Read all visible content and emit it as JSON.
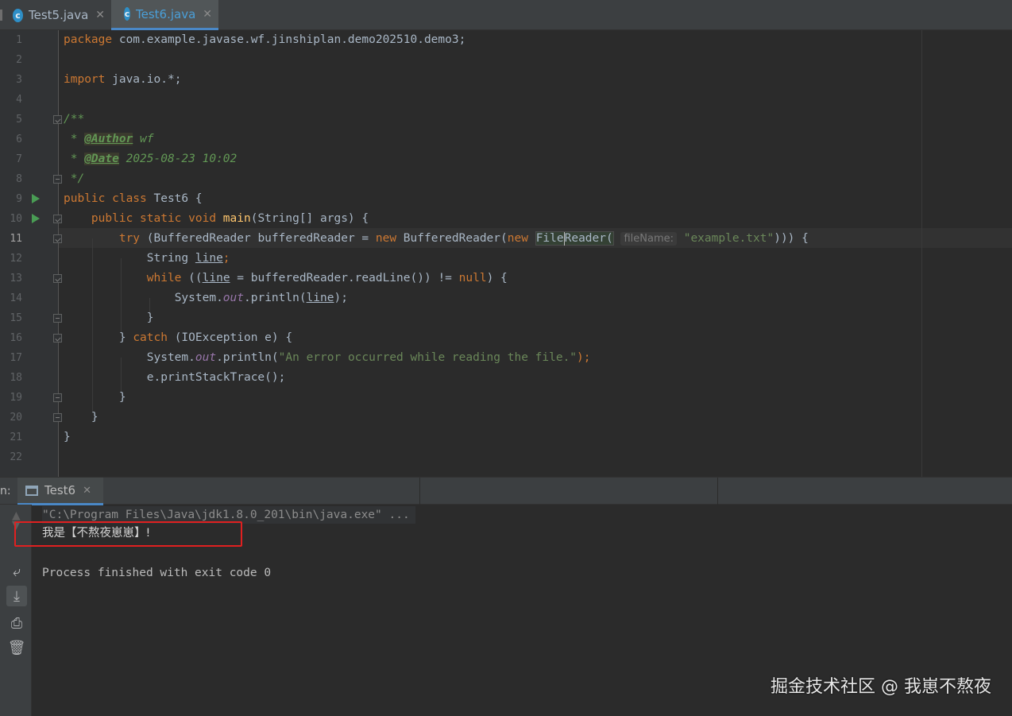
{
  "tabs": [
    {
      "label": "Test5.java",
      "icon": "c",
      "active": false
    },
    {
      "label": "Test6.java",
      "icon": "c",
      "active": true
    }
  ],
  "editor": {
    "line_numbers": [
      "1",
      "2",
      "3",
      "4",
      "5",
      "6",
      "7",
      "8",
      "9",
      "10",
      "11",
      "12",
      "13",
      "14",
      "15",
      "16",
      "17",
      "18",
      "19",
      "20",
      "21",
      "22"
    ],
    "current_line": "11",
    "code": {
      "l1_kw": "package",
      "l1_rest": " com.example.javase.wf.jinshiplan.demo202510.demo3;",
      "l3_kw": "import",
      "l3_rest": " java.io.*;",
      "l5": "/**",
      "l6_star": " * ",
      "l6_tag": "@Author",
      "l6_val": " wf",
      "l7_star": " * ",
      "l7_tag": "@Date",
      "l7_val": " 2025-08-23 10:02",
      "l8": " */",
      "l9_kw": "public class",
      "l9_rest": " Test6 {",
      "l10_indent": "    ",
      "l10_kw": "public static void",
      "l10_fn": "main",
      "l10_rest": "(String[] args) {",
      "l11_indent": "        ",
      "l11_try": "try",
      "l11_a": " (BufferedReader bufferedReader = ",
      "l11_new1": "new",
      "l11_b": " BufferedReader(",
      "l11_new2": "new",
      "l11_c": " ",
      "l11_file": "File",
      "l11_reader": "Reader(",
      "l11_hint": "fileName:",
      "l11_str": "\"example.txt\"",
      "l11_end": "))) {",
      "l12_indent": "            ",
      "l12_a": "String ",
      "l12_var": "line",
      "l12_end": ";",
      "l13_indent": "            ",
      "l13_kw": "while",
      "l13_a": " ((",
      "l13_var": "line",
      "l13_b": " = bufferedReader.readLine()) != ",
      "l13_null": "null",
      "l13_end": ") {",
      "l14_indent": "                ",
      "l14_a": "System.",
      "l14_out": "out",
      "l14_b": ".println(",
      "l14_var": "line",
      "l14_end": ");",
      "l15": "            }",
      "l16_a": "        } ",
      "l16_kw": "catch",
      "l16_b": " (IOException e) {",
      "l17_indent": "            ",
      "l17_a": "System.",
      "l17_out": "out",
      "l17_b": ".println(",
      "l17_str": "\"An error occurred while reading the file.\"",
      "l17_end": ");",
      "l18": "            e.printStackTrace();",
      "l19": "        }",
      "l20": "    }",
      "l21": "}"
    }
  },
  "run_panel": {
    "label": "n:",
    "tab_label": "Test6",
    "command": "\"C:\\Program Files\\Java\\jdk1.8.0_201\\bin\\java.exe\" ...",
    "output": "我是【不熬夜崽崽】!",
    "exit_message": "Process finished with exit code 0"
  },
  "watermark": "掘金技术社区 @ 我崽不熬夜",
  "colors": {
    "highlight_box": "#e02020",
    "keyword": "#cc7832",
    "string": "#6a8759",
    "run_arrow": "#499c54"
  }
}
